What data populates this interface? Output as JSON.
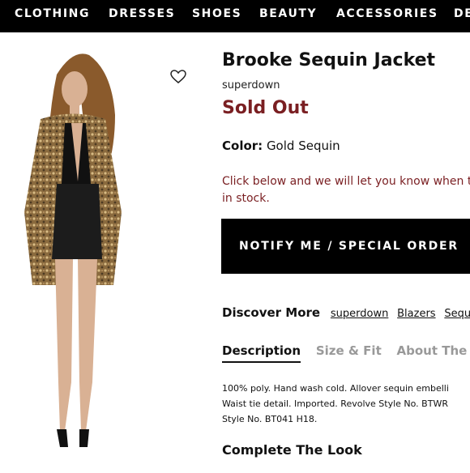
{
  "nav": {
    "items": [
      "CLOTHING",
      "DRESSES",
      "SHOES",
      "BEAUTY",
      "ACCESSORIES",
      "DE"
    ]
  },
  "product": {
    "title": "Brooke Sequin Jacket",
    "brand": "superdown",
    "status": "Sold Out",
    "color_label": "Color:",
    "color_value": "Gold Sequin",
    "notify_line1": "Click below and we will let you know when t",
    "notify_line2": "in stock.",
    "notify_button": "NOTIFY ME / SPECIAL ORDER",
    "image_icon": "heart-icon"
  },
  "discover": {
    "label": "Discover More",
    "links": [
      "superdown",
      "Blazers",
      "Sequi"
    ]
  },
  "tabs": [
    "Description",
    "Size & Fit",
    "About The B"
  ],
  "description": {
    "line1": "100% poly. Hand wash cold. Allover sequin embelli",
    "line2": "Waist tie detail. Imported. Revolve Style No. BTWR",
    "line3": "Style No. BT041 H18."
  },
  "complete_the_look": "Complete The Look",
  "colors": {
    "nav_bg": "#000000",
    "sold_out": "#7a1f22",
    "button_bg": "#000000"
  }
}
